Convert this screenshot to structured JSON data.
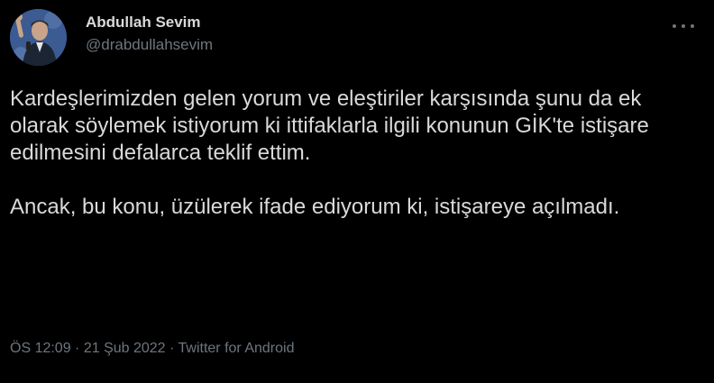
{
  "author": {
    "display_name": "Abdullah Sevim",
    "handle": "@drabdullahsevim",
    "avatar_icon": "profile-photo"
  },
  "tweet": {
    "paragraphs": [
      "Kardeşlerimizden gelen yorum ve eleştiriler karşısında şunu da ek olarak söylemek istiyorum ki ittifaklarla ilgili konunun GİK'te istişare edilmesini defalarca teklif ettim.",
      "Ancak, bu konu, üzülerek ifade ediyorum ki, istişareye açılmadı."
    ]
  },
  "meta": {
    "time": "ÖS 12:09",
    "separator": " · ",
    "date": "21 Şub 2022",
    "source": "Twitter for Android"
  },
  "colors": {
    "background": "#000000",
    "text": "#d9d9d9",
    "secondary": "#6e767d"
  },
  "icons": {
    "more": "more-horizontal-icon"
  }
}
